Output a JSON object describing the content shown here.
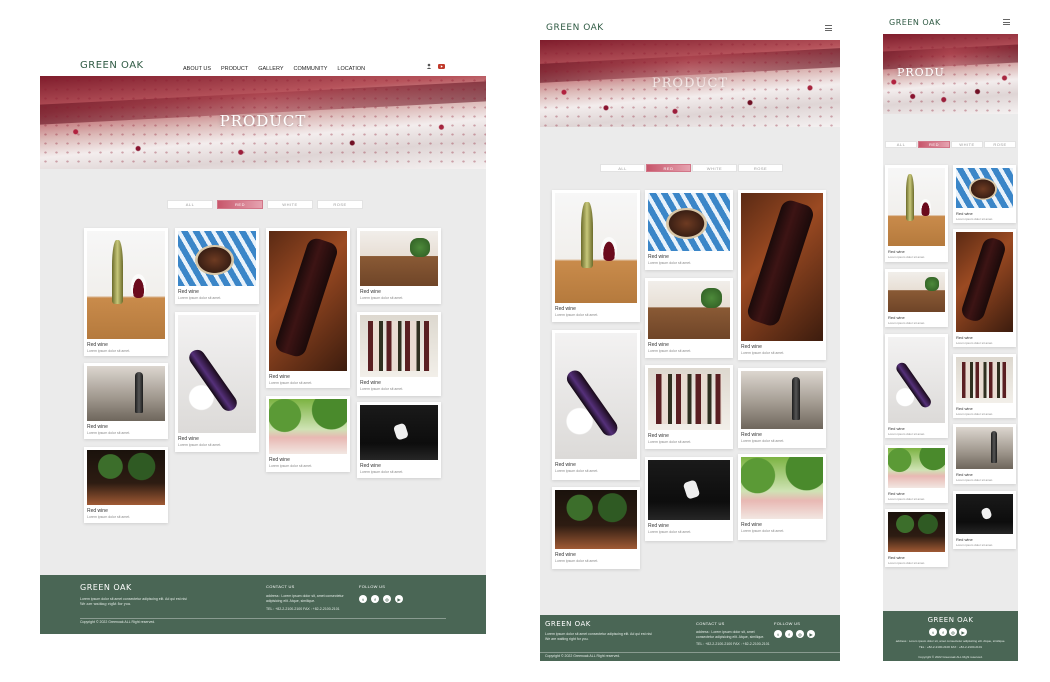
{
  "brand": "GREEN OAK",
  "nav": [
    "ABOUT US",
    "PRODUCT",
    "GALLERY",
    "COMMUNITY",
    "LOCATION"
  ],
  "hero_title": "PRODUCT",
  "hero_title_tablet": "PRODUCT",
  "hero_title_mobile": "PRODU",
  "filters": [
    "ALL",
    "RED",
    "WHITE",
    "ROSE"
  ],
  "card": {
    "title": "Red wine",
    "desc": "Lorem ipsum dolor sit amet."
  },
  "footer": {
    "logo": "GREEN OAK",
    "tagline1": "Lorem ipsum dolor sit amet consectetur adipiscing elit. Ad qui est nisi",
    "tagline2": "We are waiting right for you.",
    "copyright": "Copyright © 2022 Greenoak ALL Right reserved.",
    "contact_title": "CONTACT US",
    "address": "address : Lorem ipsum dolor sit, amet consectetur adipisicing elit. Atque, similique.",
    "tel": "TEL : +82-2-2100-2100 FAX : +82-2-2100-2101",
    "follow_title": "FOLLOW US",
    "social": [
      "twitter-icon",
      "facebook-icon",
      "instagram-icon",
      "youtube-icon"
    ]
  },
  "colors": {
    "green": "#4a6655",
    "accent": "#c7566b",
    "brand": "#2f5a43"
  }
}
